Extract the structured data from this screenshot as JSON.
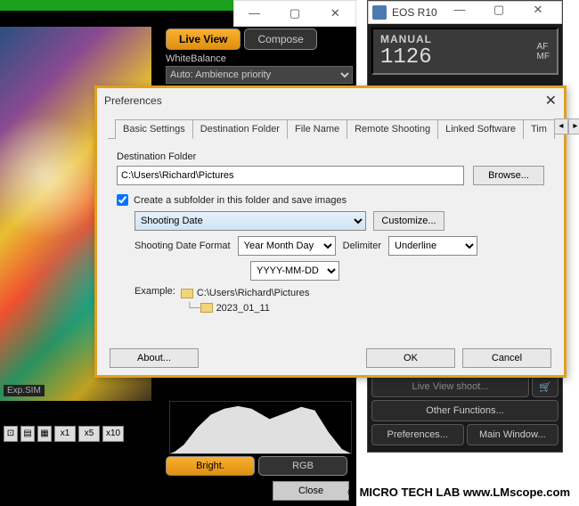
{
  "camera": {
    "title": "EOS R10",
    "mode": "MANUAL",
    "number": "1126",
    "af_label": "AF",
    "mf_label": "MF",
    "live_view_shoot": "Live View shoot...",
    "other_functions": "Other Functions...",
    "preferences": "Preferences...",
    "main_window": "Main Window..."
  },
  "liveview": {
    "live_btn": "Live View",
    "compose_btn": "Compose",
    "wb_label": "WhiteBalance",
    "wb_value": "Auto: Ambience priority",
    "expsim": "Exp.SIM",
    "zoom": [
      "x1",
      "x5",
      "x10"
    ],
    "bright_btn": "Bright.",
    "rgb_btn": "RGB",
    "close_btn": "Close"
  },
  "prefs": {
    "title": "Preferences",
    "tabs": [
      "Basic Settings",
      "Destination Folder",
      "File Name",
      "Remote Shooting",
      "Linked Software",
      "Tim"
    ],
    "dest_label": "Destination Folder",
    "dest_path": "C:\\Users\\Richard\\Pictures",
    "browse": "Browse...",
    "create_sub": "Create a subfolder in this folder and save images",
    "shooting_date": "Shooting Date",
    "customize": "Customize...",
    "format_label": "Shooting Date Format",
    "format_val": "Year Month Day",
    "delim_label": "Delimiter",
    "delim_val": "Underline",
    "pattern": "YYYY-MM-DD",
    "example_label": "Example:",
    "example_path": "C:\\Users\\Richard\\Pictures",
    "example_sub": "2023_01_11",
    "about": "About...",
    "ok": "OK",
    "cancel": "Cancel"
  },
  "copyright": "©  MICRO TECH LAB  www.LMscope.com"
}
